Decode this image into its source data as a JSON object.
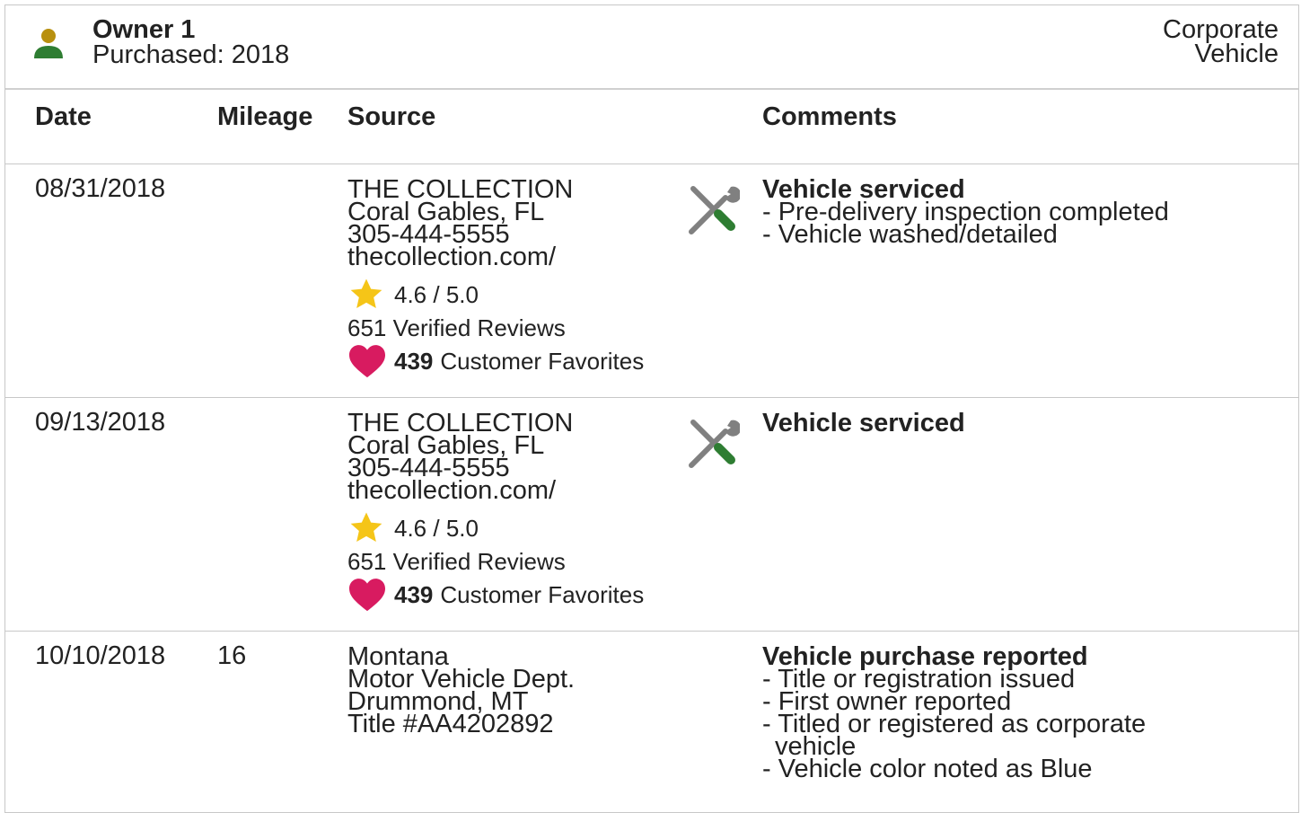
{
  "owner": {
    "title": "Owner 1",
    "purchased": "Purchased: 2018",
    "type_line1": "Corporate",
    "type_line2": "Vehicle"
  },
  "columns": {
    "date": "Date",
    "mileage": "Mileage",
    "source": "Source",
    "comments": "Comments"
  },
  "rows": [
    {
      "date": "08/31/2018",
      "mileage": "",
      "source": [
        "THE COLLECTION",
        "Coral Gables, FL",
        "305-444-5555",
        "thecollection.com/"
      ],
      "rating": "4.6 / 5.0",
      "reviews": "651 Verified Reviews",
      "favorites_count": "439",
      "favorites_label": "Customer Favorites",
      "icon": "service-tools-icon",
      "comment_title": "Vehicle serviced",
      "comment_items": [
        "Pre-delivery inspection completed",
        "Vehicle washed/detailed"
      ]
    },
    {
      "date": "09/13/2018",
      "mileage": "",
      "source": [
        "THE COLLECTION",
        "Coral Gables, FL",
        "305-444-5555",
        "thecollection.com/"
      ],
      "rating": "4.6 / 5.0",
      "reviews": "651 Verified Reviews",
      "favorites_count": "439",
      "favorites_label": "Customer Favorites",
      "icon": "service-tools-icon",
      "comment_title": "Vehicle serviced",
      "comment_items": []
    },
    {
      "date": "10/10/2018",
      "mileage": "16",
      "source": [
        "Montana",
        "Motor Vehicle Dept.",
        "Drummond, MT",
        "Title #AA4202892"
      ],
      "comment_title": "Vehicle purchase reported",
      "comment_items": [
        "Title or registration issued",
        "First owner reported",
        "Titled or registered as corporate vehicle",
        "Vehicle color noted as Blue"
      ]
    }
  ],
  "colors": {
    "person_head": "#b8900f",
    "person_body": "#2e7d32",
    "star": "#f5c518",
    "heart": "#d81b60",
    "tool_gray": "#808080",
    "tool_green": "#2e7d32"
  }
}
